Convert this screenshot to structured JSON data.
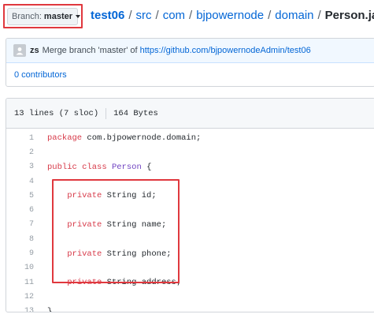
{
  "branch": {
    "label": "Branch:",
    "value": "master"
  },
  "breadcrumb": {
    "repo": "test06",
    "parts": [
      "src",
      "com",
      "bjpowernode",
      "domain"
    ],
    "sep": "/",
    "file": "Person.java"
  },
  "commit": {
    "author": "zs",
    "message": "Merge branch 'master' of",
    "link": "https://github.com/bjpowernodeAdmin/test06"
  },
  "contributors": "0 contributors",
  "file_info": {
    "lines": "13 lines (7 sloc)",
    "size": "164 Bytes"
  },
  "code": [
    {
      "n": "1",
      "tokens": [
        {
          "t": "package",
          "c": "kw"
        },
        {
          "t": " com.bjpowernode.domain;",
          "c": ""
        }
      ]
    },
    {
      "n": "2",
      "tokens": []
    },
    {
      "n": "3",
      "tokens": [
        {
          "t": "public",
          "c": "kw"
        },
        {
          "t": " ",
          "c": ""
        },
        {
          "t": "class",
          "c": "kw"
        },
        {
          "t": " ",
          "c": ""
        },
        {
          "t": "Person",
          "c": "nm"
        },
        {
          "t": " {",
          "c": ""
        }
      ]
    },
    {
      "n": "4",
      "tokens": []
    },
    {
      "n": "5",
      "tokens": [
        {
          "t": "    ",
          "c": ""
        },
        {
          "t": "private",
          "c": "kw"
        },
        {
          "t": " String id;",
          "c": ""
        }
      ]
    },
    {
      "n": "6",
      "tokens": []
    },
    {
      "n": "7",
      "tokens": [
        {
          "t": "    ",
          "c": ""
        },
        {
          "t": "private",
          "c": "kw"
        },
        {
          "t": " String name;",
          "c": ""
        }
      ]
    },
    {
      "n": "8",
      "tokens": []
    },
    {
      "n": "9",
      "tokens": [
        {
          "t": "    ",
          "c": ""
        },
        {
          "t": "private",
          "c": "kw"
        },
        {
          "t": " String phone;",
          "c": ""
        }
      ]
    },
    {
      "n": "10",
      "tokens": []
    },
    {
      "n": "11",
      "tokens": [
        {
          "t": "    ",
          "c": ""
        },
        {
          "t": "private",
          "c": "kw"
        },
        {
          "t": " String address;",
          "c": ""
        }
      ]
    },
    {
      "n": "12",
      "tokens": []
    },
    {
      "n": "13",
      "tokens": [
        {
          "t": "}",
          "c": ""
        }
      ]
    }
  ],
  "colors": {
    "link": "#0366d6",
    "keyword": "#d73a49",
    "classname": "#6f42c1",
    "highlight": "#e0383e"
  },
  "icons": {
    "branch_caret": "caret-down-icon",
    "avatar": "avatar-icon"
  }
}
